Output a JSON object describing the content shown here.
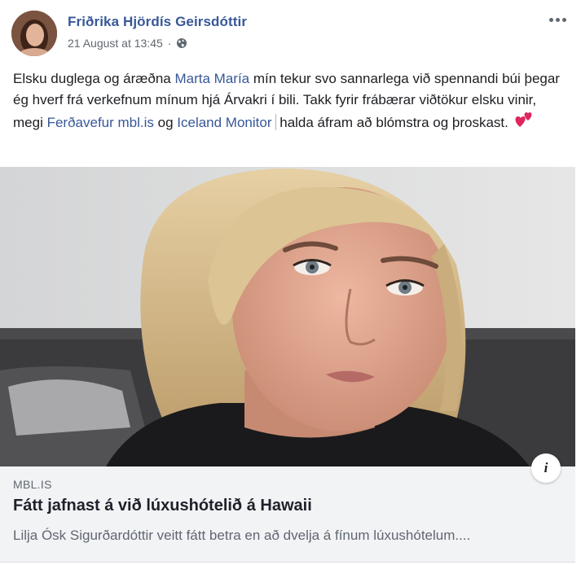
{
  "post": {
    "author": "Friðrika Hjördís Geirsdóttir",
    "timestamp": "21 August at 13:45",
    "separator": "·",
    "privacy_icon": "globe-icon",
    "text_parts": {
      "p1": "Elsku duglega og áræðna ",
      "link1": "Marta María",
      "p2": " mín tekur svo sannarlega við spennandi búi þegar ég hverf frá verkefnum mínum hjá Árvakri í bili. Takk fyrir frábærar viðtökur elsku vinir, megi ",
      "link2": "Ferðavefur mbl.is",
      "p3": " og ",
      "link3": "Iceland Monitor",
      "p4": " halda áfram að blómstra og þroskast."
    },
    "link_color": "#385898",
    "author_color": "#385898"
  },
  "preview": {
    "source": "MBL.IS",
    "headline": "Fátt jafnast á við lúxushótelið á Hawaii",
    "description": "Lilja Ósk Sigurðardóttir veitt fátt betra en að dvelja á fínum lúxushótelum....",
    "info_label": "i"
  }
}
